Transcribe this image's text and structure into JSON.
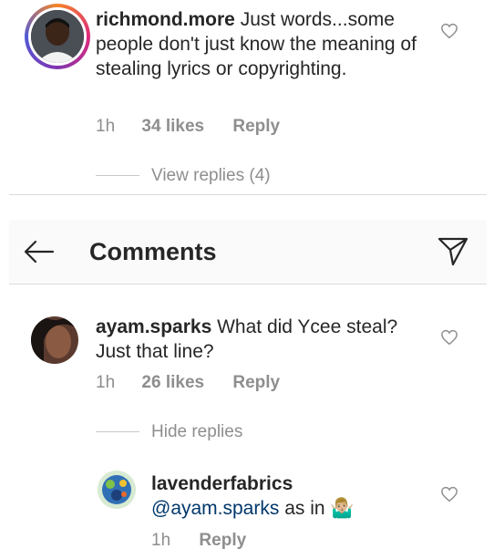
{
  "comments": [
    {
      "username": "richmond.more",
      "text": " Just words...some people don't just know the meaning of stealing lyrics or copyrighting.",
      "time": "1h",
      "likes": "34 likes",
      "reply": "Reply",
      "view_replies": "View replies (4)"
    },
    {
      "username": "ayam.sparks",
      "text": " What did Ycee steal? Just that line?",
      "time": "1h",
      "likes": "26 likes",
      "reply": "Reply",
      "hide_replies": "Hide replies"
    }
  ],
  "reply": {
    "username": "lavenderfabrics",
    "mention": "@ayam.sparks",
    "text": " as in ",
    "emoji": "🤷🏼‍♂️",
    "time": "1h",
    "reply": "Reply"
  },
  "header": {
    "title": "Comments",
    "back_icon": "arrow-left-icon",
    "share_icon": "paper-plane-icon"
  },
  "colors": {
    "text": "#262626",
    "muted": "#8e8e8e",
    "mention": "#00376b",
    "header_bg": "#fafafa"
  }
}
